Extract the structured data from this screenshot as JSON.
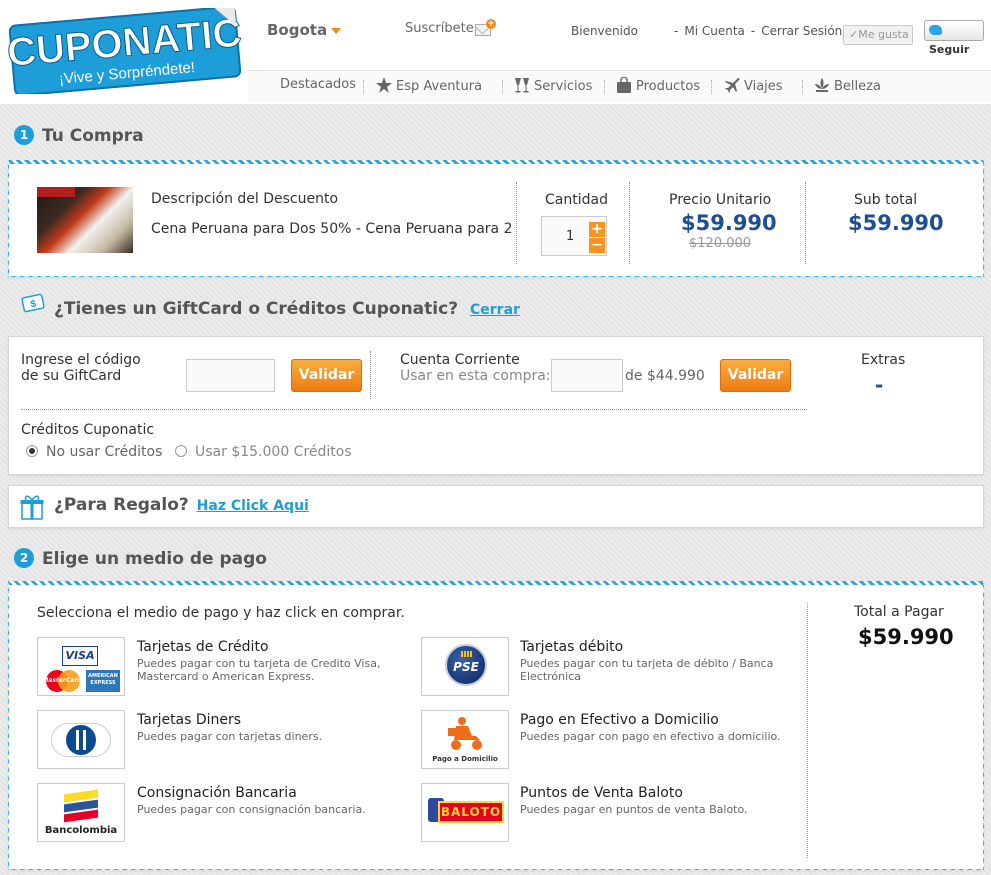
{
  "header": {
    "logo_text": "CUPONATIC",
    "logo_tagline": "¡Vive y Sorpréndete!",
    "city": "Bogota",
    "subscribe": "Suscríbete",
    "welcome": "Bienvenido",
    "account_links": [
      "-",
      "Mi Cuenta",
      "-",
      "Cerrar Sesión"
    ],
    "like": "Me gusta",
    "follow": "Seguir"
  },
  "nav": [
    {
      "label": "Destacados",
      "icon": "none"
    },
    {
      "label": "Esp Aventura",
      "icon": "star-icon"
    },
    {
      "label": "Servicios",
      "icon": "glasses-icon"
    },
    {
      "label": "Productos",
      "icon": "bag-icon"
    },
    {
      "label": "Viajes",
      "icon": "plane-icon"
    },
    {
      "label": "Belleza",
      "icon": "lotus-icon"
    }
  ],
  "purchase": {
    "step": "1",
    "title": "Tu Compra",
    "desc_label": "Descripción del Descuento",
    "desc_value": "Cena Peruana para Dos 50% - Cena Peruana para 2",
    "qty_label": "Cantidad",
    "qty_value": "1",
    "unit_price_label": "Precio Unitario",
    "unit_price": "$59.990",
    "old_price": "$120.000",
    "subtotal_label": "Sub total",
    "subtotal": "$59.990"
  },
  "giftcard": {
    "title": "¿Tienes un GiftCard o Créditos Cuponatic?",
    "close_link": "Cerrar",
    "code_label_1": "Ingrese el código",
    "code_label_2": "de su GiftCard",
    "validate": "Validar",
    "account_label": "Cuenta Corriente",
    "use_label": "Usar en esta compra:",
    "of_amount": "de $44.990",
    "extras_label": "Extras",
    "extras_value": "-",
    "credits_label": "Créditos Cuponatic",
    "no_credits": "No usar Créditos",
    "use_credits": "Usar $15.000 Créditos"
  },
  "gift": {
    "title": "¿Para Regalo?",
    "link": "Haz Click Aqui"
  },
  "payment": {
    "step": "2",
    "title": "Elige un medio de pago",
    "instruction": "Selecciona el medio de pago y haz click en comprar.",
    "total_label": "Total a Pagar",
    "total": "$59.990",
    "methods": [
      {
        "title": "Tarjetas de Crédito",
        "desc1": "Puedes pagar con tu tarjeta de Credito Visa,",
        "desc2": "Mastercard o American Express."
      },
      {
        "title": "Tarjetas débito",
        "desc1": "Puedes pagar con tu tarjeta de débito / Banca",
        "desc2": "Electrónica"
      },
      {
        "title": "Tarjetas Diners",
        "desc1": "Puedes pagar con tarjetas diners.",
        "desc2": ""
      },
      {
        "title": "Pago en Efectivo a Domicilio",
        "desc1": "Puedes pagar con pago en efectivo a domicilio.",
        "desc2": ""
      },
      {
        "title": "Consignación Bancaria",
        "desc1": "Puedes pagar con consignación bancaria.",
        "desc2": ""
      },
      {
        "title": "Puntos de Venta Baloto",
        "desc1": "Puedes pagar en puntos de venta Baloto.",
        "desc2": ""
      }
    ],
    "logos": {
      "visa": "VISA",
      "mastercard": "MasterCard",
      "amex": "AMERICAN EXPRESS",
      "pse": "PSE",
      "domicilio": "Pago a Domicilio",
      "bancolombia": "Bancolombia",
      "baloto": "BALOTO"
    }
  },
  "colors": {
    "accent_blue": "#1e9ed8",
    "price_blue": "#1d4f91",
    "orange": "#f7931e"
  }
}
